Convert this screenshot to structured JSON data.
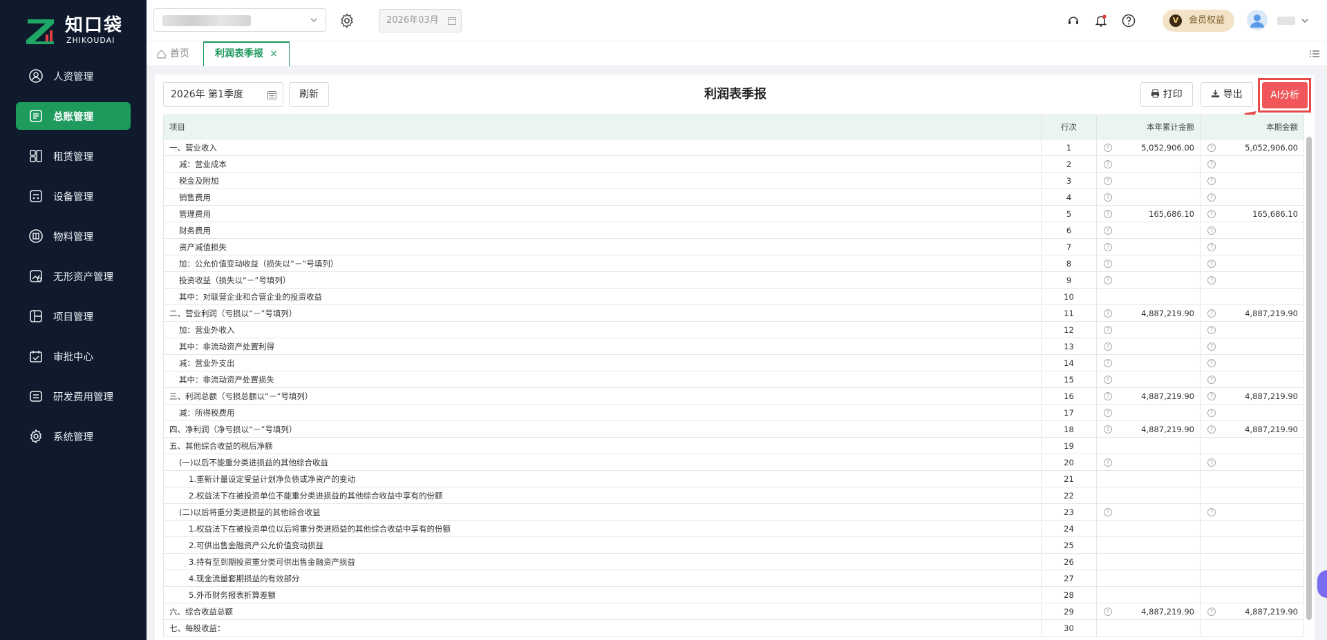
{
  "brand": {
    "name_cn": "知口袋",
    "name_en": "ZHIKOUDAI",
    "accent": "#1e9a5d"
  },
  "sidebar": {
    "items": [
      {
        "label": "人资管理",
        "icon": "user-badge-icon",
        "active": false
      },
      {
        "label": "总账管理",
        "icon": "ledger-icon",
        "active": true
      },
      {
        "label": "租赁管理",
        "icon": "lease-icon",
        "active": false
      },
      {
        "label": "设备管理",
        "icon": "device-icon",
        "active": false
      },
      {
        "label": "物料管理",
        "icon": "material-box-icon",
        "active": false
      },
      {
        "label": "无形资产管理",
        "icon": "intangible-asset-icon",
        "active": false
      },
      {
        "label": "项目管理",
        "icon": "project-icon",
        "active": false
      },
      {
        "label": "审批中心",
        "icon": "approval-calendar-icon",
        "active": false
      },
      {
        "label": "研发费用管理",
        "icon": "rd-expense-icon",
        "active": false
      },
      {
        "label": "系统管理",
        "icon": "gear-icon",
        "active": false
      }
    ]
  },
  "header": {
    "period": "2026年03月"
  },
  "tabs": {
    "home": "首页",
    "active": "利润表季报",
    "close": "×"
  },
  "toolbar": {
    "period_value": "2026年 第1季度",
    "refresh": "刷新",
    "title": "利润表季报",
    "print": "打印",
    "export": "导出",
    "ai": "AI分析"
  },
  "member": {
    "badge": "V",
    "label": "会员权益"
  },
  "table": {
    "headers": [
      "项目",
      "行次",
      "本年累计金额",
      "本期金额"
    ],
    "q_mark": "?",
    "rows": [
      {
        "item": "一、营业收入",
        "no": "1",
        "ytd": "5,052,906.00",
        "cur": "5,052,906.00",
        "indent": 0,
        "q": true
      },
      {
        "item": "减：营业成本",
        "no": "2",
        "ytd": "",
        "cur": "",
        "indent": 1,
        "q": true
      },
      {
        "item": "税金及附加",
        "no": "3",
        "ytd": "",
        "cur": "",
        "indent": 1,
        "q": true
      },
      {
        "item": "销售费用",
        "no": "4",
        "ytd": "",
        "cur": "",
        "indent": 1,
        "q": true
      },
      {
        "item": "管理费用",
        "no": "5",
        "ytd": "165,686.10",
        "cur": "165,686.10",
        "indent": 1,
        "q": true
      },
      {
        "item": "财务费用",
        "no": "6",
        "ytd": "",
        "cur": "",
        "indent": 1,
        "q": true
      },
      {
        "item": "资产减值损失",
        "no": "7",
        "ytd": "",
        "cur": "",
        "indent": 1,
        "q": true
      },
      {
        "item": "加：公允价值变动收益（损失以“－”号填列）",
        "no": "8",
        "ytd": "",
        "cur": "",
        "indent": 1,
        "q": true
      },
      {
        "item": "投资收益（损失以“－”号填列）",
        "no": "9",
        "ytd": "",
        "cur": "",
        "indent": 1,
        "q": true
      },
      {
        "item": "其中：对联营企业和合营企业的投资收益",
        "no": "10",
        "ytd": "",
        "cur": "",
        "indent": 1,
        "q": false
      },
      {
        "item": "二、营业利润（亏损以“－”号填列）",
        "no": "11",
        "ytd": "4,887,219.90",
        "cur": "4,887,219.90",
        "indent": 0,
        "q": true
      },
      {
        "item": "加：营业外收入",
        "no": "12",
        "ytd": "",
        "cur": "",
        "indent": 1,
        "q": true
      },
      {
        "item": "其中：非流动资产处置利得",
        "no": "13",
        "ytd": "",
        "cur": "",
        "indent": 1,
        "q": true
      },
      {
        "item": "减：营业外支出",
        "no": "14",
        "ytd": "",
        "cur": "",
        "indent": 1,
        "q": true
      },
      {
        "item": "其中：非流动资产处置损失",
        "no": "15",
        "ytd": "",
        "cur": "",
        "indent": 1,
        "q": true
      },
      {
        "item": "三、利润总额（亏损总额以“－”号填列）",
        "no": "16",
        "ytd": "4,887,219.90",
        "cur": "4,887,219.90",
        "indent": 0,
        "q": true
      },
      {
        "item": "减：所得税费用",
        "no": "17",
        "ytd": "",
        "cur": "",
        "indent": 1,
        "q": true
      },
      {
        "item": "四、净利润（净亏损以“－”号填列）",
        "no": "18",
        "ytd": "4,887,219.90",
        "cur": "4,887,219.90",
        "indent": 0,
        "q": true
      },
      {
        "item": "五、其他综合收益的税后净额",
        "no": "19",
        "ytd": "",
        "cur": "",
        "indent": 0,
        "q": false
      },
      {
        "item": "(一)以后不能重分类进损益的其他综合收益",
        "no": "20",
        "ytd": "",
        "cur": "",
        "indent": 1,
        "q": true
      },
      {
        "item": "1.重新计量设定受益计划净负债或净资产的变动",
        "no": "21",
        "ytd": "",
        "cur": "",
        "indent": 2,
        "q": false
      },
      {
        "item": "2.权益法下在被投资单位不能重分类进损益的其他综合收益中享有的份额",
        "no": "22",
        "ytd": "",
        "cur": "",
        "indent": 2,
        "q": false
      },
      {
        "item": "(二)以后将重分类进损益的其他综合收益",
        "no": "23",
        "ytd": "",
        "cur": "",
        "indent": 1,
        "q": true
      },
      {
        "item": "1.权益法下在被投资单位以后将重分类进损益的其他综合收益中享有的份额",
        "no": "24",
        "ytd": "",
        "cur": "",
        "indent": 2,
        "q": false
      },
      {
        "item": "2.可供出售金融资产公允价值变动损益",
        "no": "25",
        "ytd": "",
        "cur": "",
        "indent": 2,
        "q": false
      },
      {
        "item": "3.持有至到期投资重分类可供出售金融资产损益",
        "no": "26",
        "ytd": "",
        "cur": "",
        "indent": 2,
        "q": false
      },
      {
        "item": "4.现金流量套期损益的有效部分",
        "no": "27",
        "ytd": "",
        "cur": "",
        "indent": 2,
        "q": false
      },
      {
        "item": "5.外币财务报表折算差额",
        "no": "28",
        "ytd": "",
        "cur": "",
        "indent": 2,
        "q": false
      },
      {
        "item": "六、综合收益总额",
        "no": "29",
        "ytd": "4,887,219.90",
        "cur": "4,887,219.90",
        "indent": 0,
        "q": true
      },
      {
        "item": "七、每股收益：",
        "no": "30",
        "ytd": "",
        "cur": "",
        "indent": 0,
        "q": false
      }
    ]
  }
}
